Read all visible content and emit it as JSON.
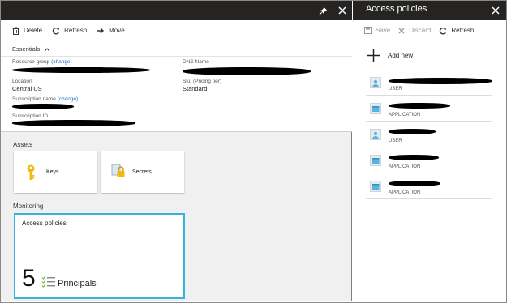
{
  "left_blade": {
    "toolbar": {
      "delete_label": "Delete",
      "refresh_label": "Refresh",
      "move_label": "Move"
    },
    "essentials": {
      "header": "Essentials",
      "resource_group_label": "Resource group",
      "resource_group_link": "(change)",
      "location_label": "Location",
      "location_value": "Central US",
      "subscription_name_label": "Subscription name",
      "subscription_name_link": "(change)",
      "subscription_id_label": "Subscription ID",
      "dns_name_label": "DNS Name",
      "sku_label": "Sku (Pricing tier)",
      "sku_value": "Standard"
    },
    "assets": {
      "title": "Assets",
      "tiles": [
        {
          "label": "Keys",
          "icon": "key-icon"
        },
        {
          "label": "Secrets",
          "icon": "secret-lock-icon"
        }
      ]
    },
    "monitoring": {
      "title": "Monitoring",
      "tile_title": "Access policies",
      "count": "5",
      "unit_label": "Principals"
    }
  },
  "right_blade": {
    "title": "Access policies",
    "toolbar": {
      "save_label": "Save",
      "discard_label": "Discard",
      "refresh_label": "Refresh"
    },
    "add_new_label": "Add new",
    "policies": [
      {
        "type": "USER"
      },
      {
        "type": "APPLICATION"
      },
      {
        "type": "USER"
      },
      {
        "type": "APPLICATION"
      },
      {
        "type": "APPLICATION"
      }
    ]
  },
  "colors": {
    "title_bar": "#252423",
    "accent_link": "#1b64c8",
    "tile_highlight": "#38b1e0",
    "key_gold": "#f2b90f"
  }
}
